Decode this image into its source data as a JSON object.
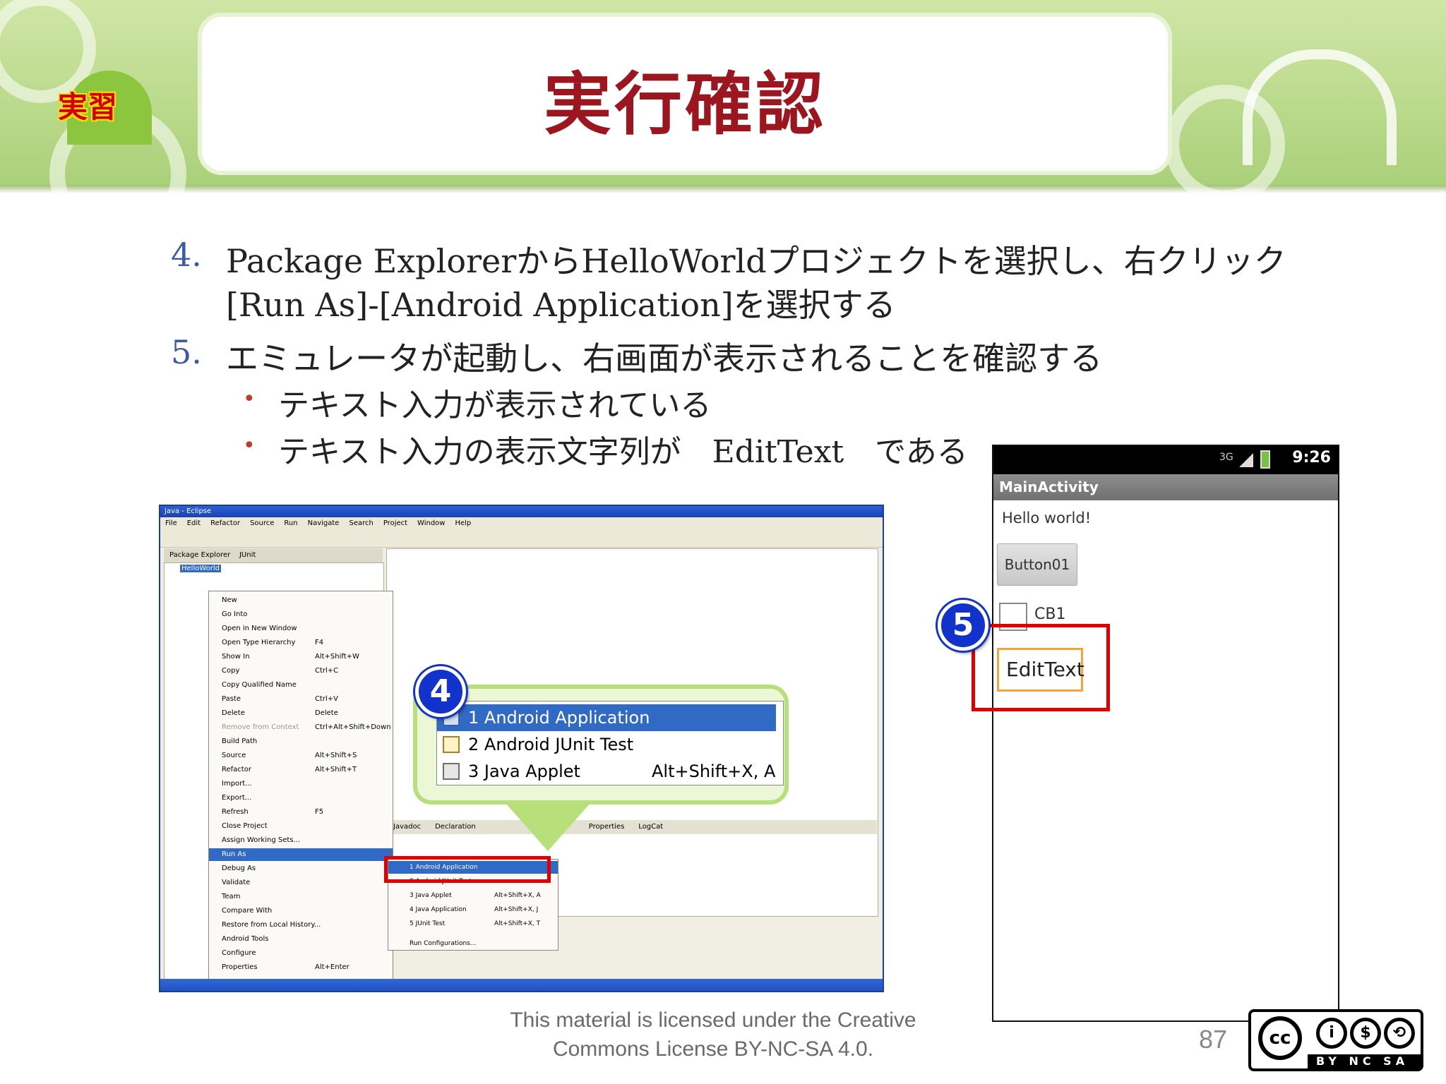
{
  "slide": {
    "badge": "実習",
    "title": "実行確認",
    "steps": [
      {
        "num": "4.",
        "lines": [
          "Package ExplorerからHelloWorldプロジェクトを選択し、右クリック",
          "[Run As]-[Android Application]を選択する"
        ]
      },
      {
        "num": "5.",
        "lines": [
          "エミュレータが起動し、右画面が表示されることを確認する"
        ]
      }
    ],
    "bullets": [
      "テキスト入力が表示されている",
      "テキスト入力の表示文字列が　EditText　である"
    ],
    "step_badges": {
      "four": "4",
      "five": "5"
    },
    "footer": [
      "This material is licensed under the Creative",
      "Commons License BY-NC-SA 4.0."
    ],
    "page_number": "87",
    "license_badge": {
      "cc": "cc",
      "terms": "BY NC SA"
    }
  },
  "eclipse": {
    "title": "Java - Eclipse",
    "menubar": [
      "File",
      "Edit",
      "Refactor",
      "Source",
      "Run",
      "Navigate",
      "Search",
      "Project",
      "Window",
      "Help"
    ],
    "views": {
      "package_explorer": "Package Explorer",
      "junit": "JUnit",
      "selected_project": "HelloWorld"
    },
    "bottom_tabs": [
      "Javadoc",
      "Declaration",
      "Properties",
      "LogCat"
    ],
    "context_menu": [
      {
        "label": "New",
        "shortcut": ""
      },
      {
        "label": "Go Into",
        "shortcut": ""
      },
      {
        "label": "Open in New Window",
        "shortcut": ""
      },
      {
        "label": "Open Type Hierarchy",
        "shortcut": "F4"
      },
      {
        "label": "Show In",
        "shortcut": "Alt+Shift+W"
      },
      {
        "label": "Copy",
        "shortcut": "Ctrl+C"
      },
      {
        "label": "Copy Qualified Name",
        "shortcut": ""
      },
      {
        "label": "Paste",
        "shortcut": "Ctrl+V"
      },
      {
        "label": "Delete",
        "shortcut": "Delete"
      },
      {
        "label": "Remove from Context",
        "shortcut": "Ctrl+Alt+Shift+Down"
      },
      {
        "label": "Build Path",
        "shortcut": ""
      },
      {
        "label": "Source",
        "shortcut": "Alt+Shift+S"
      },
      {
        "label": "Refactor",
        "shortcut": "Alt+Shift+T"
      },
      {
        "label": "Import...",
        "shortcut": ""
      },
      {
        "label": "Export...",
        "shortcut": ""
      },
      {
        "label": "Refresh",
        "shortcut": "F5"
      },
      {
        "label": "Close Project",
        "shortcut": ""
      },
      {
        "label": "Assign Working Sets...",
        "shortcut": ""
      },
      {
        "label": "Run As",
        "shortcut": ""
      },
      {
        "label": "Debug As",
        "shortcut": ""
      },
      {
        "label": "Validate",
        "shortcut": ""
      },
      {
        "label": "Team",
        "shortcut": ""
      },
      {
        "label": "Compare With",
        "shortcut": ""
      },
      {
        "label": "Restore from Local History...",
        "shortcut": ""
      },
      {
        "label": "Android Tools",
        "shortcut": ""
      },
      {
        "label": "Configure",
        "shortcut": ""
      },
      {
        "label": "Properties",
        "shortcut": "Alt+Enter"
      }
    ],
    "run_as_submenu": [
      {
        "label": "1 Android Application",
        "shortcut": ""
      },
      {
        "label": "2 Android JUnit Test",
        "shortcut": ""
      },
      {
        "label": "3 Java Applet",
        "shortcut": "Alt+Shift+X, A"
      },
      {
        "label": "4 Java Application",
        "shortcut": "Alt+Shift+X, J"
      },
      {
        "label": "5 JUnit Test",
        "shortcut": "Alt+Shift+X, T"
      },
      {
        "label": "Run Configurations...",
        "shortcut": ""
      }
    ]
  },
  "zoom": {
    "items": [
      {
        "label": "1 Android Application",
        "shortcut": ""
      },
      {
        "label": "2 Android JUnit Test",
        "shortcut": ""
      },
      {
        "label": "3 Java Applet",
        "shortcut": "Alt+Shift+X, A"
      }
    ]
  },
  "emulator": {
    "time": "9:26",
    "network": "3G",
    "app_title": "MainActivity",
    "hello": "Hello world!",
    "button": "Button01",
    "checkbox": "CB1",
    "edittext": "EditText"
  },
  "colors": {
    "title": "#9c1620",
    "highlight_box": "#e00000",
    "step_badge": "#1133cc",
    "selection": "#316ac5",
    "header_green": "#b9d98a"
  }
}
